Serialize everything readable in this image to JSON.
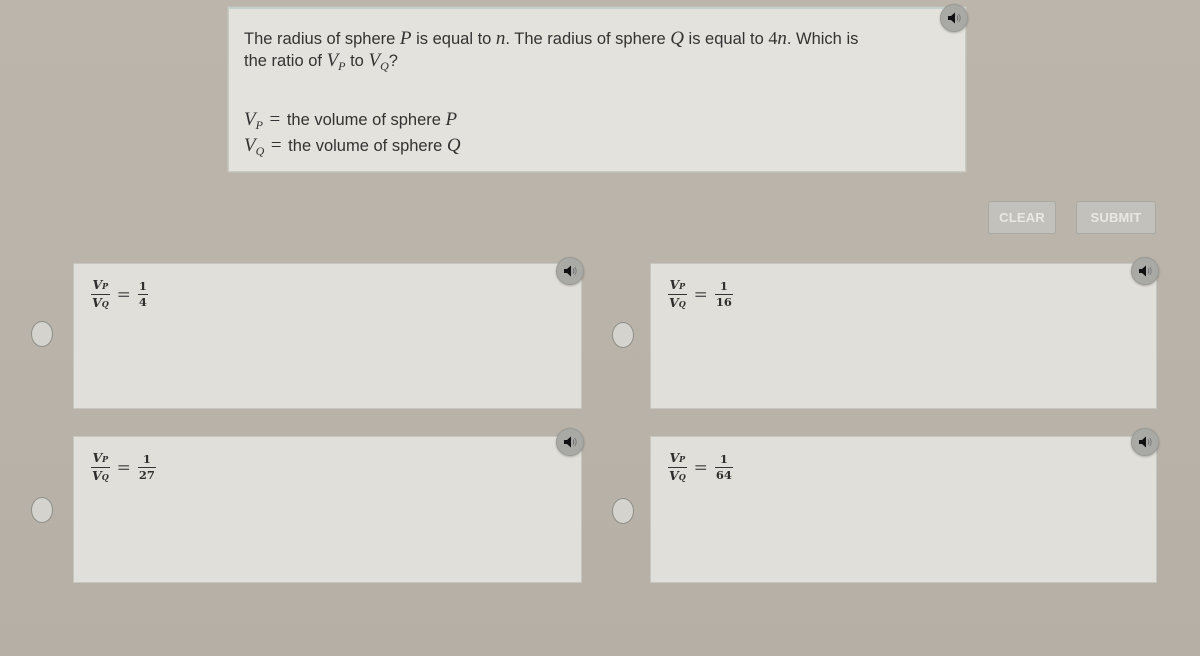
{
  "question": {
    "line1_parts": {
      "a": "The radius of sphere ",
      "P": "P",
      "b": " is equal to ",
      "n": "n",
      "c": ". The radius of sphere ",
      "Q": "Q",
      "d": " is equal to ",
      "four": "4",
      "n2": "n",
      "e": ". Which is"
    },
    "line2_parts": {
      "a": "the ratio of ",
      "V1": "V",
      "sub1": "P",
      "b": " to ",
      "V2": "V",
      "sub2": "Q",
      "c": "?"
    },
    "definitions": [
      {
        "var": "V",
        "sub": "P",
        "eq": "=",
        "text": " the volume of sphere ",
        "sphere": "P"
      },
      {
        "var": "V",
        "sub": "Q",
        "eq": "=",
        "text": " the volume of sphere ",
        "sphere": "Q"
      }
    ]
  },
  "speaker_icon": "speaker-icon",
  "buttons": {
    "clear": "CLEAR",
    "submit": "SUBMIT"
  },
  "choices": [
    {
      "lhs_num_var": "V",
      "lhs_num_sub": "P",
      "lhs_den_var": "V",
      "lhs_den_sub": "Q",
      "eq": "=",
      "num": "1",
      "den": "4"
    },
    {
      "lhs_num_var": "V",
      "lhs_num_sub": "P",
      "lhs_den_var": "V",
      "lhs_den_sub": "Q",
      "eq": "=",
      "num": "1",
      "den": "16"
    },
    {
      "lhs_num_var": "V",
      "lhs_num_sub": "P",
      "lhs_den_var": "V",
      "lhs_den_sub": "Q",
      "eq": "=",
      "num": "1",
      "den": "27"
    },
    {
      "lhs_num_var": "V",
      "lhs_num_sub": "P",
      "lhs_den_var": "V",
      "lhs_den_sub": "Q",
      "eq": "=",
      "num": "1",
      "den": "64"
    }
  ],
  "colors": {
    "background": "#b9b3a9",
    "panel": "#e3e2dc",
    "button": "#c2c1bb",
    "button_text": "#e9e8e2",
    "speaker": "#a9aaa6"
  }
}
